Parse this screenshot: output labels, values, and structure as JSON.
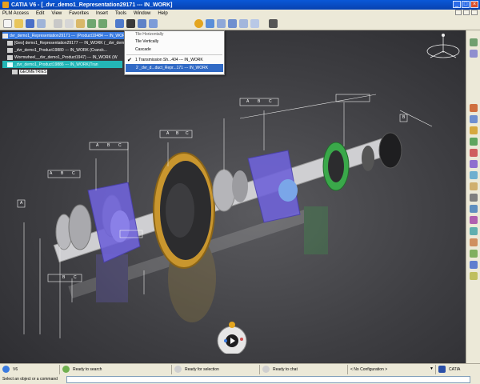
{
  "window": {
    "title": "CATIA V6 - [_dvr_demo1_Representation29171 --- IN_WORK]",
    "buttons": [
      "_",
      "□",
      "×"
    ]
  },
  "menu": {
    "items": [
      "PLM Access",
      "Edit",
      "View",
      "Favorites",
      "Insert",
      "Tools",
      "Window",
      "Help"
    ]
  },
  "tree": {
    "rows": [
      {
        "label": "dvr_demo1_Representation29171 --- "
      },
      {
        "label": "[Geo]  demo1_Representation29177 --- IN_WORK ( _dvr_dem"
      },
      {
        "label": "_dvr_demo1_Product19880 --- IN_WORK (Cranck..."
      },
      {
        "label": "Wormwheel__dvr_demo1_Product1947) --- IN_WORK (W"
      },
      {
        "label": "_dvr_demo1_Product19886 --- IN_WORK(Tran"
      },
      {
        "label": "GEOMETRIES"
      }
    ],
    "root_suffix": "(Product19484 --- IN_WORK"
  },
  "window_menu": {
    "items": [
      {
        "label": "Tile Horizontally"
      },
      {
        "label": "Tile Vertically"
      },
      {
        "label": "Cascade"
      },
      {
        "label": "1 Transmission Sh...404 --- IN_WORK",
        "checked": true
      },
      {
        "label": "2 _dvr_d...duct_Repr...171 --- IN_WORK",
        "highlighted": true
      }
    ]
  },
  "annotations": {
    "labels": [
      "A",
      "B",
      "C",
      "A",
      "B",
      "C",
      "A",
      "B",
      "C",
      "A",
      "B",
      "C",
      "B",
      "A",
      "B",
      "C"
    ]
  },
  "status": {
    "app_label": "V6",
    "search": "Ready to search",
    "selection": "Ready for selection",
    "chat": "Ready to chat",
    "configuration": "< No Configuration >",
    "brand": "CATIA"
  },
  "command": {
    "prompt": "Select an object or a command"
  },
  "colors": {
    "titlebar": "#0842b0",
    "selection": "#316ac5",
    "cyan_row": "#23b6b6",
    "part_blue": "#6f63d8",
    "gear": "#c9962e",
    "part_green": "#3aa84a"
  }
}
